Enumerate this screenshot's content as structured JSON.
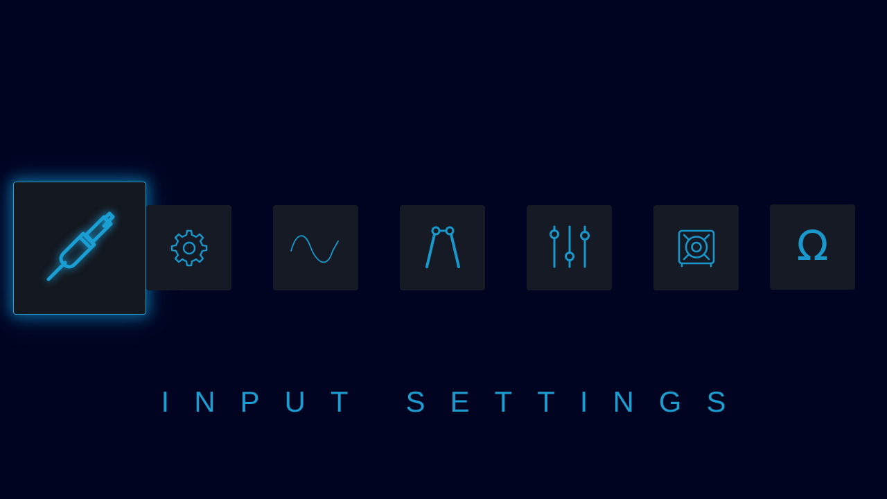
{
  "menu": {
    "selected_label": "INPUT SETTINGS",
    "selected_index": 0,
    "items": [
      {
        "id": "input",
        "icon": "audio-jack-icon"
      },
      {
        "id": "settings",
        "icon": "gear-icon"
      },
      {
        "id": "waveform",
        "icon": "sine-wave-icon"
      },
      {
        "id": "tuner",
        "icon": "tuning-fork-icon"
      },
      {
        "id": "mixer",
        "icon": "mixer-sliders-icon"
      },
      {
        "id": "speaker",
        "icon": "speaker-cabinet-icon"
      },
      {
        "id": "impedance",
        "icon": "omega-icon",
        "glyph": "Ω"
      }
    ]
  },
  "colors": {
    "background": "#000420",
    "tile": "#161a24",
    "accent": "#1d9ccf"
  }
}
